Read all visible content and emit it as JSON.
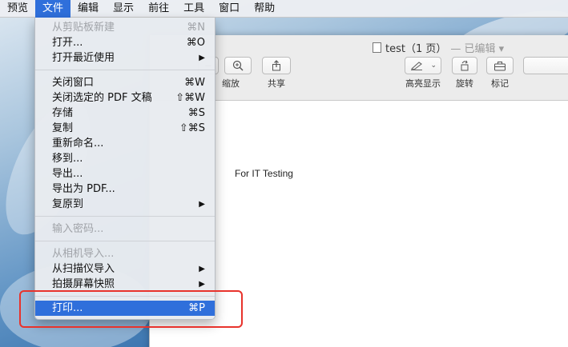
{
  "menubar": {
    "items": [
      "预览",
      "文件",
      "编辑",
      "显示",
      "前往",
      "工具",
      "窗口",
      "帮助"
    ]
  },
  "file_menu": {
    "items": [
      {
        "label": "从剪贴板新建",
        "shortcut": "⌘N",
        "disabled": true
      },
      {
        "label": "打开...",
        "shortcut": "⌘O"
      },
      {
        "label": "打开最近使用",
        "submenu": "▶"
      },
      {
        "label": "关闭窗口",
        "shortcut": "⌘W"
      },
      {
        "label": "关闭选定的 PDF 文稿",
        "shortcut": "⇧⌘W"
      },
      {
        "label": "存储",
        "shortcut": "⌘S"
      },
      {
        "label": "复制",
        "shortcut": "⇧⌘S"
      },
      {
        "label": "重新命名..."
      },
      {
        "label": "移到..."
      },
      {
        "label": "导出..."
      },
      {
        "label": "导出为 PDF..."
      },
      {
        "label": "复原到",
        "submenu": "▶"
      },
      {
        "label": "输入密码...",
        "disabled": true
      },
      {
        "label": "从相机导入...",
        "disabled": true
      },
      {
        "label": "从扫描仪导入",
        "submenu": "▶"
      },
      {
        "label": "拍摄屏幕快照",
        "submenu": "▶"
      },
      {
        "label": "打印...",
        "shortcut": "⌘P",
        "highlighted": true
      }
    ]
  },
  "window": {
    "doc_name": "test（1 页）",
    "edited_label": "— 已编辑 ▾",
    "toolbar": {
      "zoom_label": "缩放",
      "share_label": "共享",
      "highlight_label": "高亮显示",
      "rotate_label": "旋转",
      "markup_label": "标记"
    },
    "document_text": "For IT Testing"
  }
}
